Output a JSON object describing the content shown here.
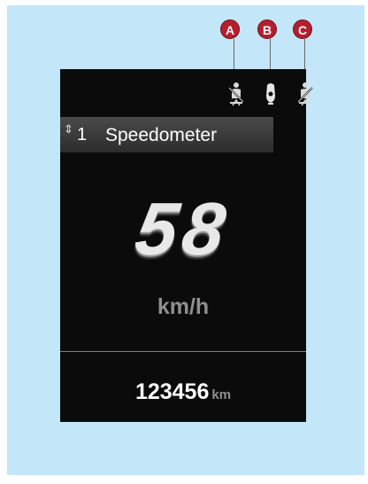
{
  "markers": [
    "A",
    "B",
    "C"
  ],
  "marker_color": "#b41f2e",
  "icons": [
    "seatbelt-left-icon",
    "seat-occupancy-icon",
    "seatbelt-right-icon"
  ],
  "menu": {
    "arrows": "⇕",
    "number": "1",
    "title": "Speedometer"
  },
  "speed": {
    "value": "58",
    "unit": "km/h"
  },
  "odometer": {
    "value": "123456",
    "unit": "km"
  }
}
